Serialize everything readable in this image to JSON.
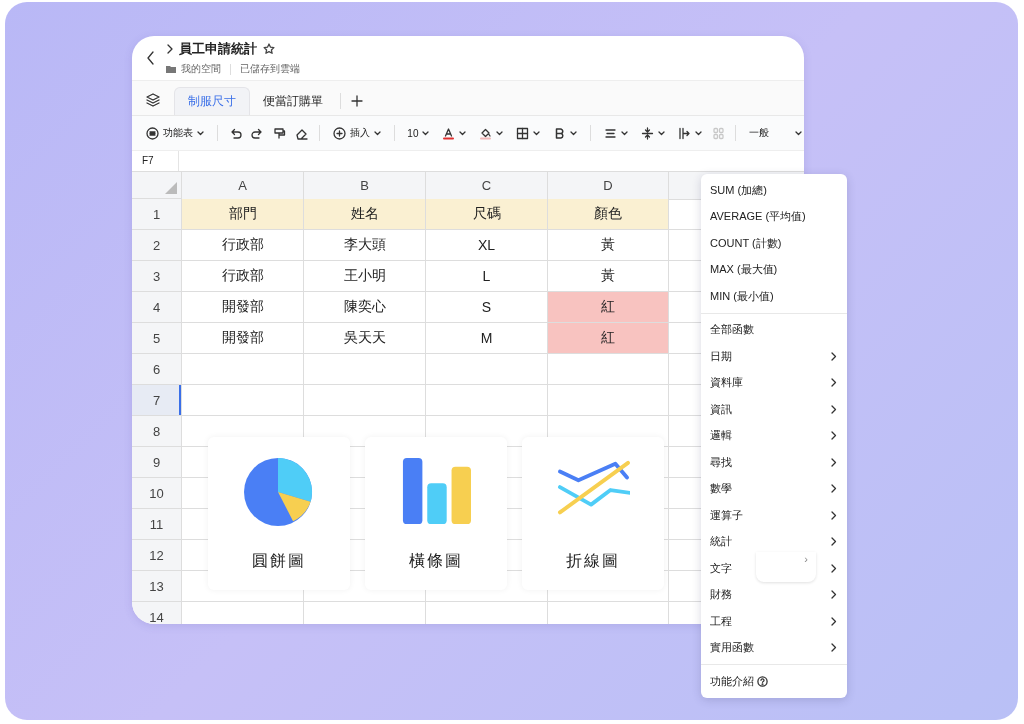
{
  "header": {
    "title": "員工申請統計",
    "starred": false,
    "folder": "我的空間",
    "status": "已儲存到雲端"
  },
  "tabs": [
    {
      "label": "制服尺寸",
      "selected": true
    },
    {
      "label": "便當訂購單",
      "selected": false
    }
  ],
  "toolbar": {
    "function_menu": "功能表",
    "insert": "插入",
    "font_size": "10",
    "number_format": "一般",
    "merge_disabled": true
  },
  "cell_ref": "F7",
  "sheet": {
    "columns": [
      "A",
      "B",
      "C",
      "D"
    ],
    "rows": [
      {
        "number": "1",
        "selected": false,
        "cells": [
          {
            "text": "部門",
            "color": "#faf0d2"
          },
          {
            "text": "姓名",
            "color": "#faf0d2"
          },
          {
            "text": "尺碼",
            "color": "#faf0d2"
          },
          {
            "text": "顏色",
            "color": "#faf0d2"
          }
        ]
      },
      {
        "number": "2",
        "selected": false,
        "cells": [
          {
            "text": "行政部"
          },
          {
            "text": "李大頭"
          },
          {
            "text": "XL"
          },
          {
            "text": "黃"
          }
        ]
      },
      {
        "number": "3",
        "selected": false,
        "cells": [
          {
            "text": "行政部"
          },
          {
            "text": "王小明"
          },
          {
            "text": "L"
          },
          {
            "text": "黃"
          }
        ]
      },
      {
        "number": "4",
        "selected": false,
        "cells": [
          {
            "text": "開發部"
          },
          {
            "text": "陳奕心"
          },
          {
            "text": "S"
          },
          {
            "text": "紅",
            "color": "#f8c3c0"
          }
        ]
      },
      {
        "number": "5",
        "selected": false,
        "cells": [
          {
            "text": "開發部"
          },
          {
            "text": "吳天天"
          },
          {
            "text": "M"
          },
          {
            "text": "紅",
            "color": "#f8c3c0"
          }
        ]
      },
      {
        "number": "6",
        "selected": false,
        "cells": []
      },
      {
        "number": "7",
        "selected": true,
        "cells": []
      },
      {
        "number": "8",
        "selected": false,
        "cells": []
      },
      {
        "number": "9",
        "selected": false,
        "cells": []
      },
      {
        "number": "10",
        "selected": false,
        "cells": []
      },
      {
        "number": "11",
        "selected": false,
        "cells": []
      },
      {
        "number": "12",
        "selected": false,
        "cells": []
      },
      {
        "number": "13",
        "selected": false,
        "cells": []
      },
      {
        "number": "14",
        "selected": false,
        "cells": []
      }
    ]
  },
  "chart_options": [
    {
      "kind": "pie",
      "label": "圓餅圖"
    },
    {
      "kind": "bar",
      "label": "橫條圖"
    },
    {
      "kind": "line",
      "label": "折線圖"
    }
  ],
  "function_menu": {
    "sections": [
      [
        {
          "label": "SUM (加總)",
          "submenu": false
        },
        {
          "label": "AVERAGE (平均值)",
          "submenu": false
        },
        {
          "label": "COUNT (計數)",
          "submenu": false
        },
        {
          "label": "MAX (最大值)",
          "submenu": false
        },
        {
          "label": "MIN (最小值)",
          "submenu": false
        }
      ],
      [
        {
          "label": "全部函數",
          "submenu": false
        },
        {
          "label": "日期",
          "submenu": true
        },
        {
          "label": "資料庫",
          "submenu": true
        },
        {
          "label": "資訊",
          "submenu": true
        },
        {
          "label": "邏輯",
          "submenu": true
        },
        {
          "label": "尋找",
          "submenu": true
        },
        {
          "label": "數學",
          "submenu": true
        },
        {
          "label": "運算子",
          "submenu": true
        },
        {
          "label": "統計",
          "submenu": true
        },
        {
          "label": "文字",
          "submenu": true
        },
        {
          "label": "財務",
          "submenu": true
        },
        {
          "label": "工程",
          "submenu": true
        },
        {
          "label": "實用函數",
          "submenu": true
        }
      ],
      [
        {
          "label": "功能介紹",
          "submenu": false,
          "help": true
        }
      ]
    ],
    "stray_chevron": "›"
  }
}
